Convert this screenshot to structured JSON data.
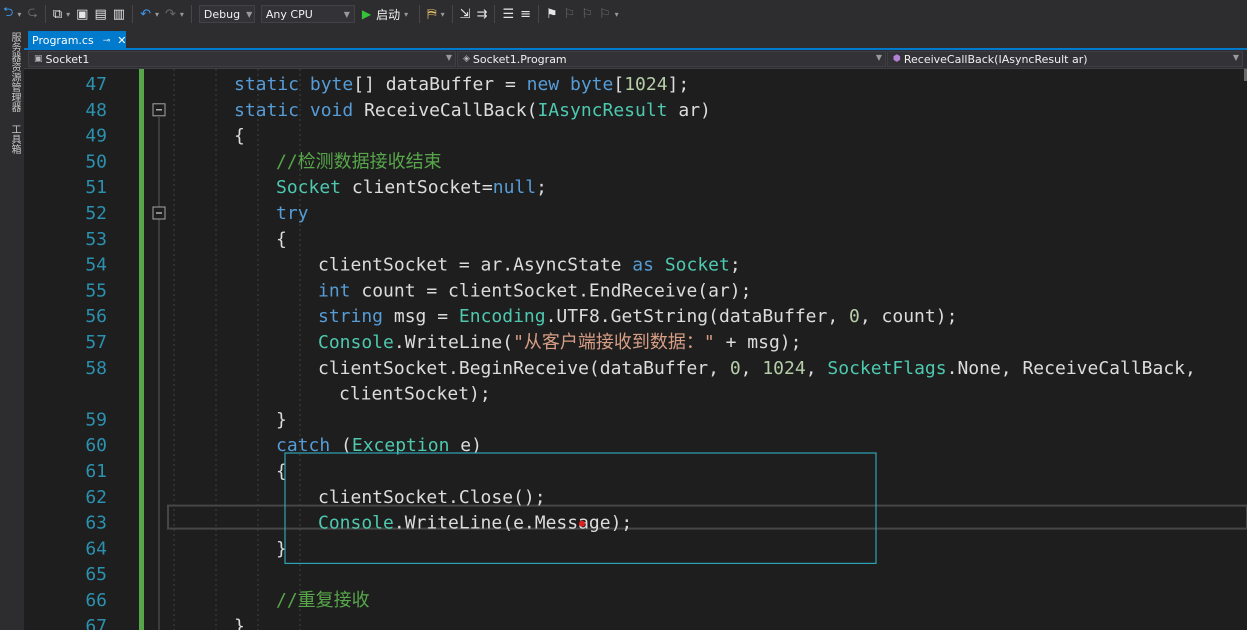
{
  "toolbar": {
    "config_value": "Debug",
    "platform_value": "Any CPU",
    "start_label": "启动"
  },
  "side_tabs": [
    "服务器资源管理器",
    "工具箱"
  ],
  "tab": {
    "title": "Program.cs",
    "pin_glyph": "⊸",
    "close_glyph": "✕"
  },
  "nav": {
    "project": "Socket1",
    "type": "Socket1.Program",
    "member": "ReceiveCallBack(IAsyncResult ar)"
  },
  "colors": {
    "keyword": "#569cd6",
    "type": "#4ec9b0",
    "text": "#dcdcdc",
    "string": "#d69d85",
    "comment": "#57a64a",
    "number": "#b5cea8",
    "line_number": "#2b91af",
    "change_bar": "#57a64a",
    "highlight_box": "#2ea3b4",
    "accent": "#007acc"
  },
  "editor": {
    "lines": [
      {
        "n": "47",
        "ind": 2,
        "fold": "",
        "tokens": [
          [
            "static",
            "kw"
          ],
          [
            " ",
            "t"
          ],
          [
            "byte",
            "kw"
          ],
          [
            "[] dataBuffer = ",
            "t"
          ],
          [
            "new",
            "kw"
          ],
          [
            " ",
            "t"
          ],
          [
            "byte",
            "kw"
          ],
          [
            "[",
            "t"
          ],
          [
            "1024",
            "num"
          ],
          [
            "];",
            "t"
          ]
        ]
      },
      {
        "n": "48",
        "ind": 2,
        "fold": "-",
        "tokens": [
          [
            "static",
            "kw"
          ],
          [
            " ",
            "t"
          ],
          [
            "void",
            "kw"
          ],
          [
            " ReceiveCallBack(",
            "t"
          ],
          [
            "IAsyncResult",
            "ty"
          ],
          [
            " ar)",
            "t"
          ]
        ]
      },
      {
        "n": "49",
        "ind": 2,
        "fold": "",
        "tokens": [
          [
            "{",
            "t"
          ]
        ]
      },
      {
        "n": "50",
        "ind": 3,
        "fold": "",
        "tokens": [
          [
            "//检测数据接收结束",
            "cm"
          ]
        ]
      },
      {
        "n": "51",
        "ind": 3,
        "fold": "",
        "tokens": [
          [
            "Socket",
            "ty"
          ],
          [
            " clientSocket=",
            "t"
          ],
          [
            "null",
            "kw"
          ],
          [
            ";",
            "t"
          ]
        ]
      },
      {
        "n": "52",
        "ind": 3,
        "fold": "-",
        "tokens": [
          [
            "try",
            "kw"
          ]
        ]
      },
      {
        "n": "53",
        "ind": 3,
        "fold": "",
        "tokens": [
          [
            "{",
            "t"
          ]
        ]
      },
      {
        "n": "54",
        "ind": 4,
        "fold": "",
        "tokens": [
          [
            "clientSocket = ar.AsyncState ",
            "t"
          ],
          [
            "as",
            "kw"
          ],
          [
            " ",
            "t"
          ],
          [
            "Socket",
            "ty"
          ],
          [
            ";",
            "t"
          ]
        ]
      },
      {
        "n": "55",
        "ind": 4,
        "fold": "",
        "tokens": [
          [
            "int",
            "kw"
          ],
          [
            " count = clientSocket.EndReceive(ar);",
            "t"
          ]
        ]
      },
      {
        "n": "56",
        "ind": 4,
        "fold": "",
        "tokens": [
          [
            "string",
            "kw"
          ],
          [
            " msg = ",
            "t"
          ],
          [
            "Encoding",
            "ty"
          ],
          [
            ".UTF8.GetString(dataBuffer, ",
            "t"
          ],
          [
            "0",
            "num"
          ],
          [
            ", count);",
            "t"
          ]
        ]
      },
      {
        "n": "57",
        "ind": 4,
        "fold": "",
        "tokens": [
          [
            "Console",
            "ty"
          ],
          [
            ".WriteLine(",
            "t"
          ],
          [
            "\"从客户端接收到数据：\"",
            "str"
          ],
          [
            " + msg);",
            "t"
          ]
        ]
      },
      {
        "n": "58",
        "ind": 4,
        "fold": "",
        "tokens": [
          [
            "clientSocket.BeginReceive(dataBuffer, ",
            "t"
          ],
          [
            "0",
            "num"
          ],
          [
            ", ",
            "t"
          ],
          [
            "1024",
            "num"
          ],
          [
            ", ",
            "t"
          ],
          [
            "SocketFlags",
            "ty"
          ],
          [
            ".None, ReceiveCallBack,",
            "t"
          ]
        ]
      },
      {
        "n": "",
        "ind": 4.5,
        "fold": "",
        "tokens": [
          [
            "clientSocket);",
            "t"
          ]
        ]
      },
      {
        "n": "59",
        "ind": 3,
        "fold": "",
        "tokens": [
          [
            "}",
            "t"
          ]
        ]
      },
      {
        "n": "60",
        "ind": 3,
        "fold": "",
        "tokens": [
          [
            "catch",
            "kw"
          ],
          [
            " (",
            "t"
          ],
          [
            "Exception",
            "ty"
          ],
          [
            " e)",
            "t"
          ]
        ]
      },
      {
        "n": "61",
        "ind": 3,
        "fold": "",
        "tokens": [
          [
            "{",
            "t"
          ]
        ]
      },
      {
        "n": "62",
        "ind": 4,
        "fold": "",
        "tokens": [
          [
            "clientSocket.Close();",
            "t"
          ]
        ]
      },
      {
        "n": "63",
        "ind": 4,
        "fold": "",
        "tokens": [
          [
            "Console",
            "ty"
          ],
          [
            ".WriteLine(e.Message);",
            "t"
          ]
        ]
      },
      {
        "n": "64",
        "ind": 3,
        "fold": "",
        "tokens": [
          [
            "}",
            "t"
          ]
        ]
      },
      {
        "n": "65",
        "ind": 3,
        "fold": "",
        "tokens": [
          [
            "",
            "t"
          ]
        ]
      },
      {
        "n": "66",
        "ind": 3,
        "fold": "",
        "tokens": [
          [
            "//重复接收",
            "cm"
          ]
        ]
      },
      {
        "n": "67",
        "ind": 2,
        "fold": "",
        "tokens": [
          [
            "}",
            "t"
          ]
        ]
      }
    ]
  }
}
